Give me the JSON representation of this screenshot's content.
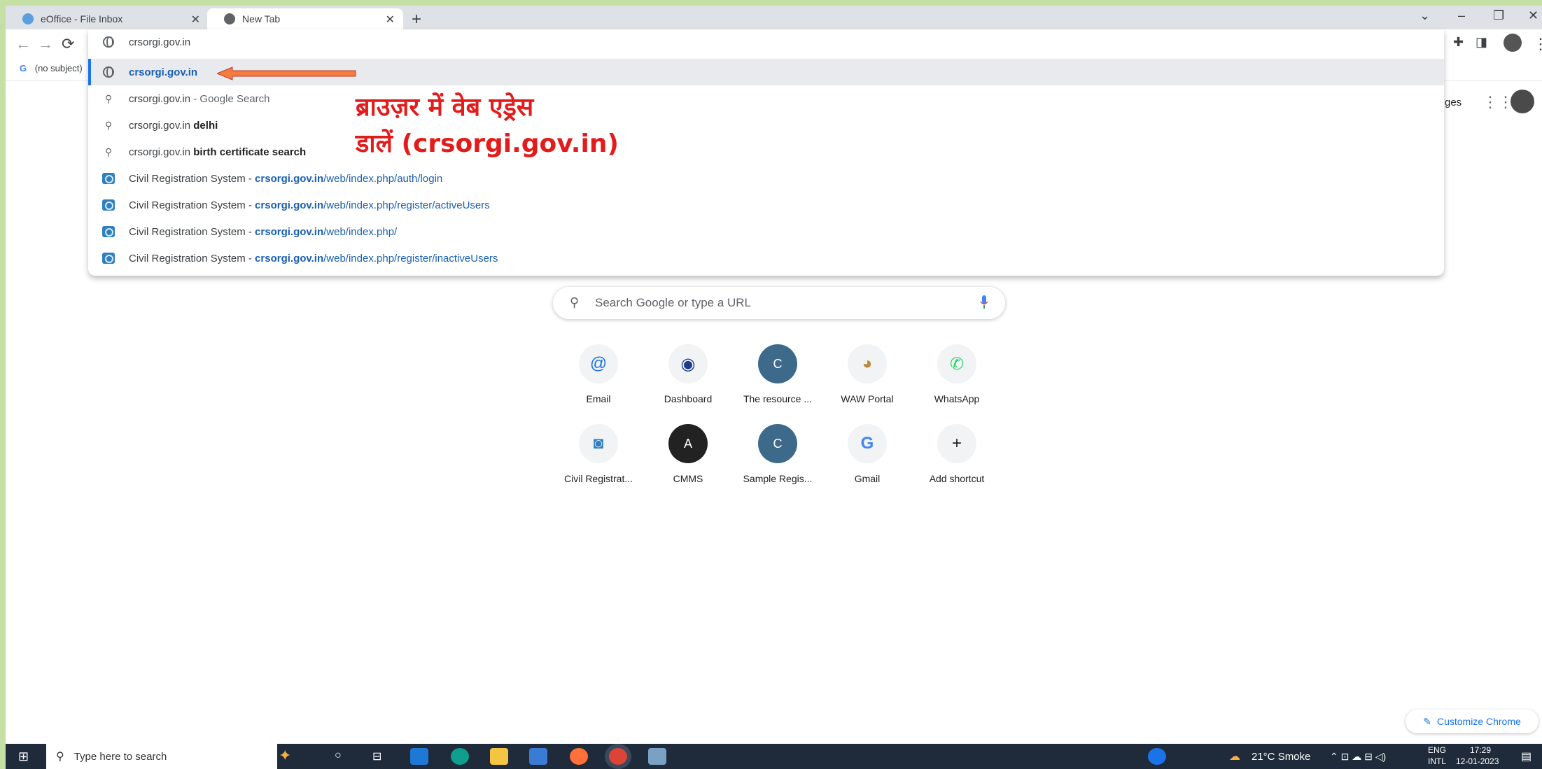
{
  "tabs": [
    {
      "title": "eOffice - File Inbox",
      "active": false
    },
    {
      "title": "New Tab",
      "active": true
    }
  ],
  "bookmarks": {
    "item": "(no subject)"
  },
  "omnibox": {
    "value": "crsorgi.gov.in"
  },
  "suggestions": {
    "s0": {
      "a": "crsorgi.gov.in"
    },
    "s1": {
      "a": "crsorgi.gov.in",
      "b": " - Google Search"
    },
    "s2": {
      "a": "crsorgi.gov.in ",
      "b": "delhi"
    },
    "s3": {
      "a": "crsorgi.gov.in ",
      "b": "birth certificate search"
    },
    "s4": {
      "a": "Civil Registration System - ",
      "b": "crsorgi.gov.in",
      "c": "/web/index.php/auth/login"
    },
    "s5": {
      "a": "Civil Registration System - ",
      "b": "crsorgi.gov.in",
      "c": "/web/index.php/register/activeUsers"
    },
    "s6": {
      "a": "Civil Registration System - ",
      "b": "crsorgi.gov.in",
      "c": "/web/index.php/"
    },
    "s7": {
      "a": "Civil Registration System - ",
      "b": "crsorgi.gov.in",
      "c": "/web/index.php/register/inactiveUsers"
    }
  },
  "annotation": {
    "line1": "ब्राउज़र में वेब एड्रेस",
    "line2": "डालें (crsorgi.gov.in)"
  },
  "header": {
    "pages": "ges"
  },
  "search": {
    "placeholder": "Search Google or type a URL"
  },
  "shortcuts": [
    {
      "label": "Email",
      "icon": "@"
    },
    {
      "label": "Dashboard",
      "icon": "◉"
    },
    {
      "label": "The resource ...",
      "icon": "C"
    },
    {
      "label": "WAW Portal",
      "icon": "◕"
    },
    {
      "label": "WhatsApp",
      "icon": "✆"
    },
    {
      "label": "Civil Registrat...",
      "icon": "◙"
    },
    {
      "label": "CMMS",
      "icon": "A"
    },
    {
      "label": "Sample Regis...",
      "icon": "C"
    },
    {
      "label": "Gmail",
      "icon": "G"
    },
    {
      "label": "Add shortcut",
      "icon": "+"
    }
  ],
  "customize": {
    "label": "Customize Chrome"
  },
  "taskbar": {
    "search_placeholder": "Type here to search",
    "weather": "21°C  Smoke",
    "lang1": "ENG",
    "lang2": "INTL",
    "time": "17:29",
    "date": "12-01-2023"
  },
  "colors": {
    "accent": "#1a73e8",
    "annotation": "#e41b1b",
    "arrow": "#f47c3c",
    "background": "#c5e0a5"
  }
}
